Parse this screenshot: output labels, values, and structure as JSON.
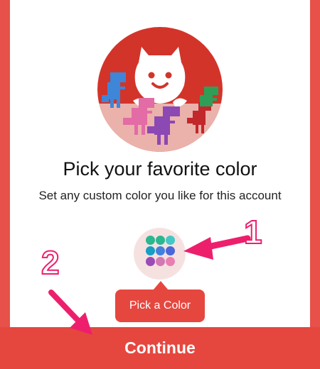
{
  "onboarding": {
    "title": "Pick your favorite color",
    "subtitle": "Set any custom color you like for this account",
    "picker_icon": "palette-dots-icon",
    "tooltip_label": "Pick a Color",
    "continue_label": "Continue"
  },
  "palette": [
    "#2bb78f",
    "#2bb78f",
    "#43c8c4",
    "#169ec3",
    "#3f81de",
    "#4b66d8",
    "#9b4bb7",
    "#d179b4",
    "#e87fb2"
  ],
  "annotations": {
    "step1": "1",
    "step2": "2",
    "color": "#ed1f6d"
  },
  "colors": {
    "accent": "#e5473f",
    "frame": "#e8504a",
    "avatar_bg": "#d3342a",
    "picker_bg": "#f6e1e1"
  }
}
